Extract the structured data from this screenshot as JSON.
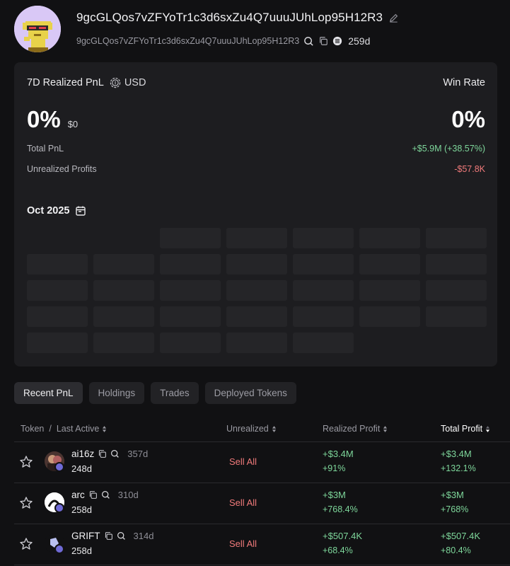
{
  "profile": {
    "name": "9gcGLQos7vZFYoTr1c3d6sxZu4Q7uuuJUhLop95H12R3",
    "address": "9gcGLQos7vZFYoTr1c3d6sxZu4Q7uuuJUhLop95H12R3",
    "age": "259d"
  },
  "pnl": {
    "title": "7D Realized PnL",
    "currency": "USD",
    "win_rate_label": "Win Rate",
    "realized_pct": "0%",
    "realized_usd": "$0",
    "win_rate": "0%",
    "total_pnl_label": "Total PnL",
    "total_pnl": "+$5.9M (+38.57%)",
    "unrealized_label": "Unrealized Profits",
    "unrealized": "-$57.8K",
    "month": "Oct 2025"
  },
  "tabs": [
    {
      "label": "Recent PnL",
      "active": true
    },
    {
      "label": "Holdings",
      "active": false
    },
    {
      "label": "Trades",
      "active": false
    },
    {
      "label": "Deployed Tokens",
      "active": false
    }
  ],
  "table": {
    "headers": {
      "token": "Token",
      "sep": "/",
      "last_active": "Last Active",
      "unrealized": "Unrealized",
      "realized": "Realized Profit",
      "total": "Total Profit"
    },
    "rows": [
      {
        "name": "ai16z",
        "age": "357d",
        "last_active": "248d",
        "action": "Sell All",
        "realized": "+$3.4M",
        "realized_pct": "+91%",
        "total": "+$3.4M",
        "total_pct": "+132.1%"
      },
      {
        "name": "arc",
        "age": "310d",
        "last_active": "258d",
        "action": "Sell All",
        "realized": "+$3M",
        "realized_pct": "+768.4%",
        "total": "+$3M",
        "total_pct": "+768%"
      },
      {
        "name": "GRIFT",
        "age": "314d",
        "last_active": "258d",
        "action": "Sell All",
        "realized": "+$507.4K",
        "realized_pct": "+68.4%",
        "total": "+$507.4K",
        "total_pct": "+80.4%"
      }
    ]
  },
  "colors": {
    "positive": "#7ed79b",
    "negative": "#f07a7a",
    "badge": "#6f6ad6"
  },
  "icons": [
    "edit-icon",
    "search-icon",
    "copy-icon",
    "chain-icon",
    "currency-icon",
    "calendar-icon",
    "sort-icon",
    "star-icon"
  ]
}
